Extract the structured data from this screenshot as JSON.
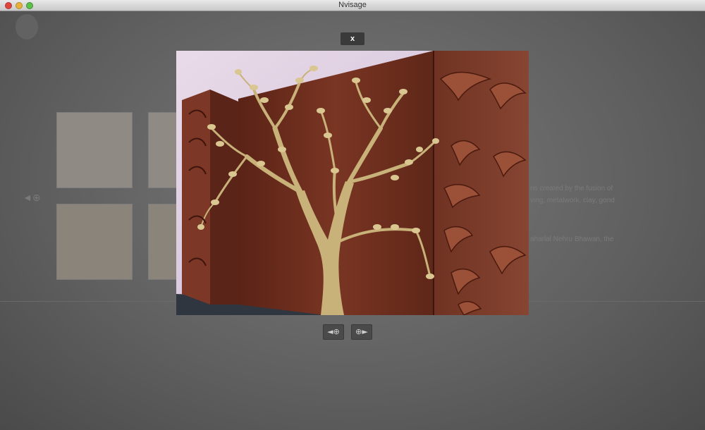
{
  "window": {
    "title": "Nvisage"
  },
  "viewer": {
    "close_label": "x",
    "prev_icon": "◄⊕",
    "next_icon": "⊕►"
  },
  "background": {
    "text_lines": [
      "ns created by the fusion of",
      "ving, metalwork, clay, gond",
      "aharlal Nehru Bhawan, the"
    ]
  },
  "colors": {
    "overlay": "#5f5f5f",
    "button": "#3a3a3a",
    "wood": "#6b2d1f",
    "brass": "#c9b27a"
  }
}
